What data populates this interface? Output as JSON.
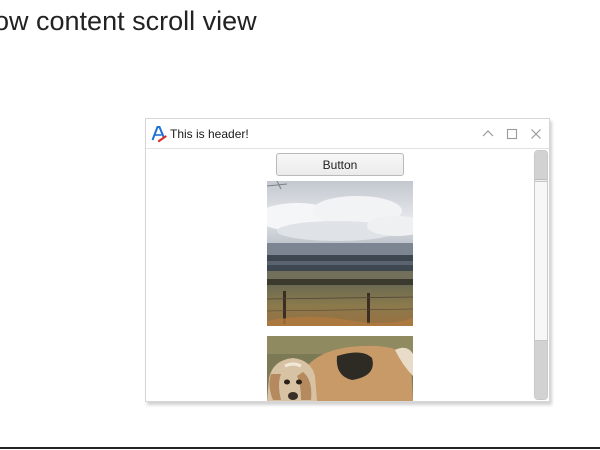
{
  "page": {
    "title": "low content scroll view"
  },
  "window": {
    "header_title": "This is header!",
    "icon": "app-logo-icon",
    "controls": {
      "minimize": "chevron-up-icon",
      "maximize": "maximize-icon",
      "close": "close-icon"
    }
  },
  "content": {
    "button_label": "Button",
    "images": [
      {
        "subject": "landscape-photo"
      },
      {
        "subject": "dog-photo"
      }
    ]
  },
  "scroll": {
    "position": 0.0
  },
  "colors": {
    "accent_blue": "#1e6fd6",
    "accent_red": "#d9302a",
    "window_border": "#d6d6d6",
    "text": "#1a1a1a"
  }
}
